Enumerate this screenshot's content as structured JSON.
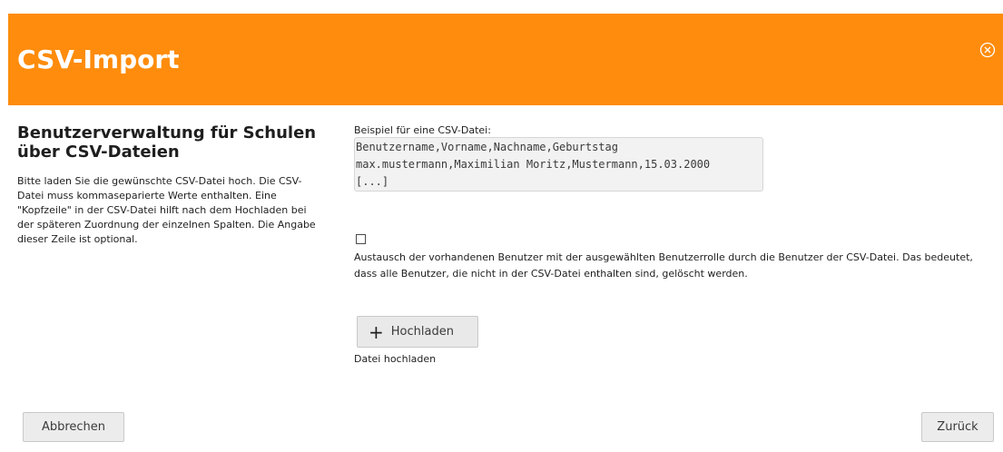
{
  "dialog": {
    "title": "CSV-Import",
    "header_color": "#ff8c0c",
    "close_icon": "close-circle-icon"
  },
  "info": {
    "heading": "Benutzerverwaltung für Schulen über CSV-Dateien",
    "description": "Bitte laden Sie die gewünschte CSV-Datei hoch. Die CSV-Datei muss kommaseparierte Werte enthalten. Eine \"Kopfzeile\" in der CSV-Datei hilft nach dem Hochladen bei der späteren Zuordnung der einzelnen Spalten. Die Angabe dieser Zeile ist optional."
  },
  "example": {
    "label": "Beispiel für eine CSV-Datei:",
    "lines": [
      "Benutzername,Vorname,Nachname,Geburtstag",
      "max.mustermann,Maximilian Moritz,Mustermann,15.03.2000",
      "[...]"
    ]
  },
  "replace_option": {
    "checked": false,
    "label": "Austausch der vorhandenen Benutzer mit der ausgewählten Benutzerrolle durch die Benutzer der CSV-Datei. Das bedeutet, dass alle Benutzer, die nicht in der CSV-Datei enthalten sind, gelöscht werden."
  },
  "upload": {
    "icon": "plus-icon",
    "button_label": "Hochladen",
    "hint": "Datei hochladen"
  },
  "footer": {
    "cancel_label": "Abbrechen",
    "back_label": "Zurück"
  }
}
